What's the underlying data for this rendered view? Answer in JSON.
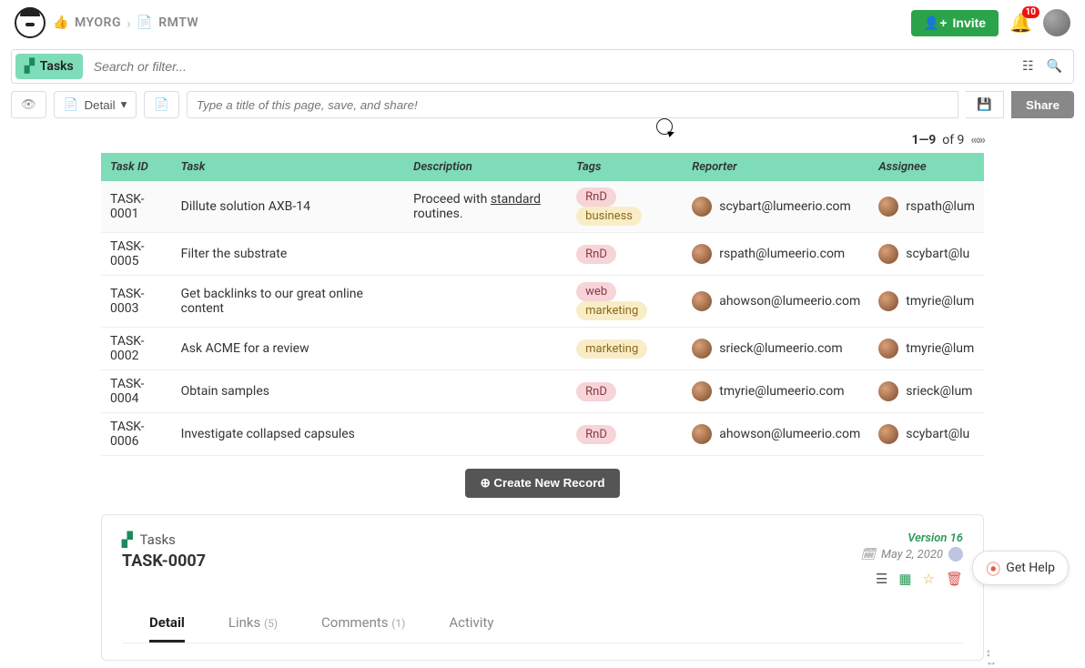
{
  "breadcrumb": {
    "org": "MYORG",
    "page": "RMTW"
  },
  "topbar": {
    "invite": "Invite",
    "notif_count": "10"
  },
  "search": {
    "tasks_label": "Tasks",
    "placeholder": "Search or filter..."
  },
  "titlebar": {
    "detail_label": "Detail",
    "title_placeholder": "Type a title of this page, save, and share!",
    "share": "Share"
  },
  "pager": {
    "range": "1—9",
    "of": "of 9"
  },
  "columns": {
    "id": "Task ID",
    "task": "Task",
    "desc": "Description",
    "tags": "Tags",
    "reporter": "Reporter",
    "assignee": "Assignee"
  },
  "rows": [
    {
      "id": "TASK-0001",
      "task": "Dillute solution AXB-14",
      "desc_pre": "Proceed with ",
      "desc_u": "standard",
      "desc_post": " routines.",
      "tags": [
        "RnD",
        "business"
      ],
      "reporter": "scybart@lumeerio.com",
      "assignee": "rspath@lum"
    },
    {
      "id": "TASK-0005",
      "task": "Filter the substrate",
      "desc_pre": "",
      "desc_u": "",
      "desc_post": "",
      "tags": [
        "RnD"
      ],
      "reporter": "rspath@lumeerio.com",
      "assignee": "scybart@lu"
    },
    {
      "id": "TASK-0003",
      "task": "Get backlinks to our great online content",
      "desc_pre": "",
      "desc_u": "",
      "desc_post": "",
      "tags": [
        "web",
        "marketing"
      ],
      "reporter": "ahowson@lumeerio.com",
      "assignee": "tmyrie@lum"
    },
    {
      "id": "TASK-0002",
      "task": "Ask ACME for a review",
      "desc_pre": "",
      "desc_u": "",
      "desc_post": "",
      "tags": [
        "marketing"
      ],
      "reporter": "srieck@lumeerio.com",
      "assignee": "tmyrie@lum"
    },
    {
      "id": "TASK-0004",
      "task": "Obtain samples",
      "desc_pre": "",
      "desc_u": "",
      "desc_post": "",
      "tags": [
        "RnD"
      ],
      "reporter": "tmyrie@lumeerio.com",
      "assignee": "srieck@lum"
    },
    {
      "id": "TASK-0006",
      "task": "Investigate collapsed capsules",
      "desc_pre": "",
      "desc_u": "",
      "desc_post": "",
      "tags": [
        "RnD"
      ],
      "reporter": "ahowson@lumeerio.com",
      "assignee": "scybart@lu"
    }
  ],
  "tag_classes": {
    "RnD": "tag-rnd",
    "business": "tag-business",
    "web": "tag-web",
    "marketing": "tag-marketing"
  },
  "create_btn": "Create New Record",
  "detail": {
    "kind": "Tasks",
    "title": "TASK-0007",
    "version": "Version 16",
    "date": "May 2, 2020",
    "tabs": {
      "detail": "Detail",
      "links": "Links",
      "links_n": "(5)",
      "comments": "Comments",
      "comments_n": "(1)",
      "activity": "Activity"
    }
  },
  "help": "Get Help"
}
